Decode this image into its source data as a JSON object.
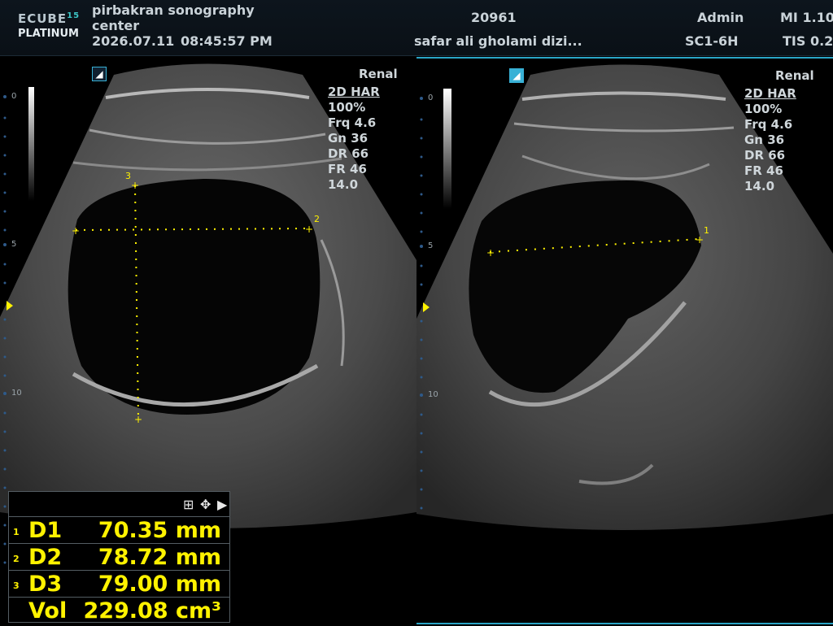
{
  "header": {
    "logo_top": "ECUBE",
    "logo_num": "15",
    "logo_bottom": "PLATINUM",
    "center_name_line1": "pirbakran sonography",
    "center_name_line2": "center",
    "date": "2026.07.11",
    "time": "08:45:57  PM",
    "patient_id": "20961",
    "patient_name": "safar ali gholami dizi...",
    "user": "Admin",
    "probe": "SC1-6H",
    "mi": "MI 1.10",
    "tis": "TIS 0.2"
  },
  "left_panel": {
    "preset": "Renal",
    "mode": "2D HAR",
    "power": "100%",
    "freq": "Frq 4.6",
    "gain": "Gn 36",
    "dr": "DR 66",
    "fr": "FR 46",
    "depth": "14.0",
    "depth_marks": [
      "0",
      "5",
      "10"
    ],
    "caliper_labels": [
      "3",
      "2"
    ]
  },
  "right_panel": {
    "preset": "Renal",
    "mode": "2D HAR",
    "power": "100%",
    "freq": "Frq 4.6",
    "gain": "Gn 36",
    "dr": "DR 66",
    "fr": "FR 46",
    "depth": "14.0",
    "depth_marks": [
      "0",
      "5",
      "10"
    ],
    "caliper_labels": [
      "1"
    ]
  },
  "measurements": {
    "rows": [
      {
        "idx": "1",
        "name": "D1",
        "value": "70.35 mm"
      },
      {
        "idx": "2",
        "name": "D2",
        "value": "78.72 mm"
      },
      {
        "idx": "3",
        "name": "D3",
        "value": "79.00 mm"
      },
      {
        "idx": "",
        "name": "Vol",
        "value": "229.08 cm³"
      }
    ]
  },
  "icons": [
    "expand-icon",
    "move-icon",
    "play-right-icon",
    "probe-orientation-icon"
  ],
  "colors": {
    "caliper": "#fff200",
    "accent": "#2aa5c6",
    "logo_accent": "#3cc6c6"
  }
}
